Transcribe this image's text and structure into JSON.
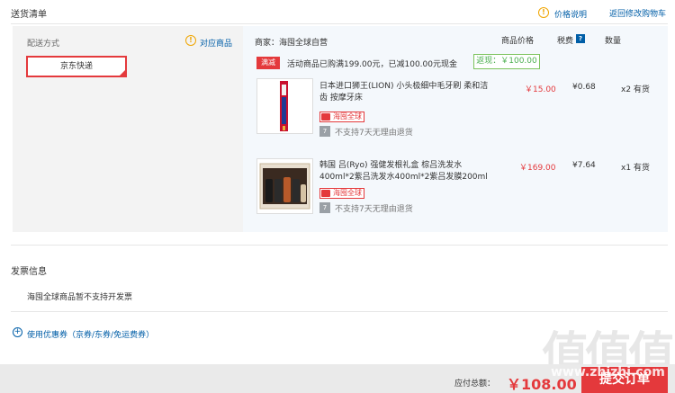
{
  "header": {
    "title": "送货清单",
    "price_note": "价格说明",
    "back_to_cart": "返回修改购物车"
  },
  "shipping": {
    "label": "配送方式",
    "match_goods": "对应商品",
    "option": "京东快递"
  },
  "store": {
    "name": "商家：海囤全球自营",
    "columns": {
      "price": "商品价格",
      "tax": "税费",
      "tax_icon": "?",
      "qty": "数量"
    },
    "promo": {
      "badge": "满减",
      "text": "活动商品已购满199.00元，已减100.00元现金",
      "cashback": "返现：￥100.00"
    },
    "products": [
      {
        "name": "日本进口狮王(LION) 小头极细中毛牙刷 柔和洁齿 按摩牙床",
        "tag": "海囤全球",
        "return_icon": "7",
        "return_text": "不支持7天无理由退货",
        "price": "￥15.00",
        "tax": "¥0.68",
        "qty": "x2 有货"
      },
      {
        "name": "韩国 吕(Ryo) 强健发根礼盒 棕吕洗发水400ml*2紫吕洗发水400ml*2紫吕发膜200ml",
        "tag": "海囤全球",
        "return_icon": "7",
        "return_text": "不支持7天无理由退货",
        "price": "￥169.00",
        "tax": "¥7.64",
        "qty": "x1 有货"
      }
    ]
  },
  "invoice": {
    "title": "发票信息",
    "note": "海囤全球商品暂不支持开发票"
  },
  "coupon": {
    "icon": "+",
    "label": "使用优惠券（京券/东券/免运费券）"
  },
  "footer": {
    "total_label": "应付总额：",
    "total_value": "￥108.00",
    "submit": "提交订单"
  },
  "watermark": {
    "glyphs": "值值值",
    "url": "www.zhizhi.com"
  },
  "colors": {
    "accent_red": "#e4393c",
    "link_blue": "#005ea7",
    "cashback_green": "#4caf50",
    "panel_grey": "#f3f3f3",
    "panel_blue": "#f4f8fc"
  }
}
